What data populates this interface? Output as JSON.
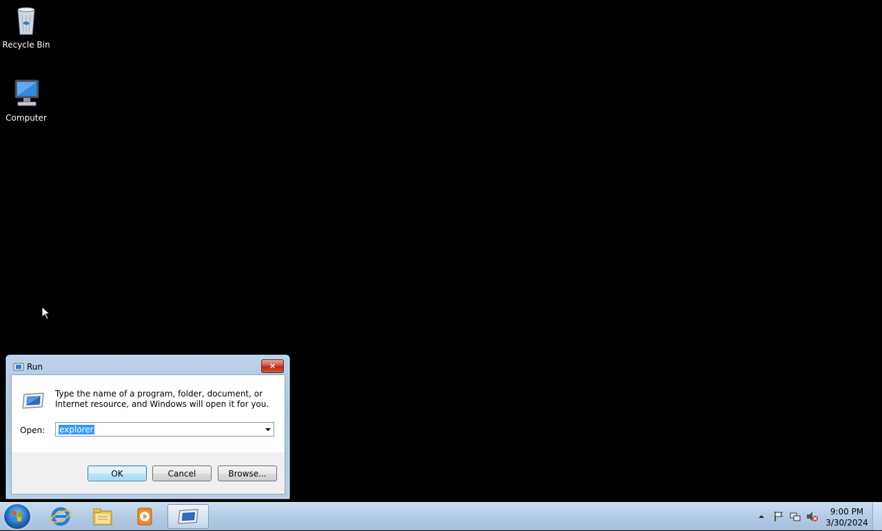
{
  "desktop": {
    "icons": [
      {
        "label": "Recycle Bin",
        "icon": "recycle-bin-icon"
      },
      {
        "label": "Computer",
        "icon": "computer-icon"
      }
    ]
  },
  "dialog": {
    "title": "Run",
    "description": "Type the name of a program, folder, document, or Internet resource, and Windows will open it for you.",
    "open_label": "Open:",
    "open_value": "explorer",
    "ok_label": "OK",
    "cancel_label": "Cancel",
    "browse_label": "Browse...",
    "close_icon": "close-icon"
  },
  "taskbar": {
    "pinned": [
      "internet-explorer-icon",
      "windows-explorer-icon",
      "media-player-icon",
      "run-icon"
    ],
    "clock_time": "9:00 PM",
    "clock_date": "3/30/2024",
    "tray_icons": [
      "show-hidden-icons-icon",
      "action-center-flag-icon",
      "network-icon",
      "volume-muted-icon"
    ]
  },
  "colors": {
    "desktop_bg": "#000000",
    "selection": "#3399ff",
    "taskbar": "#b4cbe4"
  }
}
